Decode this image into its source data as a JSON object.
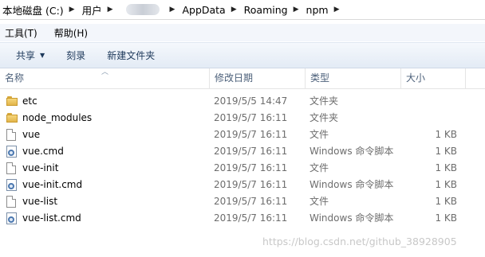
{
  "address_bar": {
    "crumbs": [
      "本地磁盘 (C:)",
      "用户",
      "AppData",
      "Roaming",
      "npm"
    ],
    "separator": "▶"
  },
  "menu": {
    "tools": "工具(T)",
    "help": "帮助(H)"
  },
  "toolbar": {
    "share": "共享",
    "burn": "刻录",
    "new_folder": "新建文件夹"
  },
  "columns": {
    "name": "名称",
    "date_modified": "修改日期",
    "type": "类型",
    "size": "大小"
  },
  "files": [
    {
      "name": "etc",
      "date": "2019/5/5 14:47",
      "type": "文件夹",
      "size": "",
      "icon": "folder-icon"
    },
    {
      "name": "node_modules",
      "date": "2019/5/7 16:11",
      "type": "文件夹",
      "size": "",
      "icon": "folder-icon"
    },
    {
      "name": "vue",
      "date": "2019/5/7 16:11",
      "type": "文件",
      "size": "1 KB",
      "icon": "file-icon"
    },
    {
      "name": "vue.cmd",
      "date": "2019/5/7 16:11",
      "type": "Windows 命令脚本",
      "size": "1 KB",
      "icon": "cmd-script-icon"
    },
    {
      "name": "vue-init",
      "date": "2019/5/7 16:11",
      "type": "文件",
      "size": "1 KB",
      "icon": "file-icon"
    },
    {
      "name": "vue-init.cmd",
      "date": "2019/5/7 16:11",
      "type": "Windows 命令脚本",
      "size": "1 KB",
      "icon": "cmd-script-icon"
    },
    {
      "name": "vue-list",
      "date": "2019/5/7 16:11",
      "type": "文件",
      "size": "1 KB",
      "icon": "file-icon"
    },
    {
      "name": "vue-list.cmd",
      "date": "2019/5/7 16:11",
      "type": "Windows 命令脚本",
      "size": "1 KB",
      "icon": "cmd-script-icon"
    }
  ],
  "watermark": "https://blog.csdn.net/github_38928905",
  "colors": {
    "toolbar_text": "#1e395b",
    "header_text": "#4c607a",
    "meta_text": "#6d6d6d",
    "folder": "#f6d77c"
  }
}
